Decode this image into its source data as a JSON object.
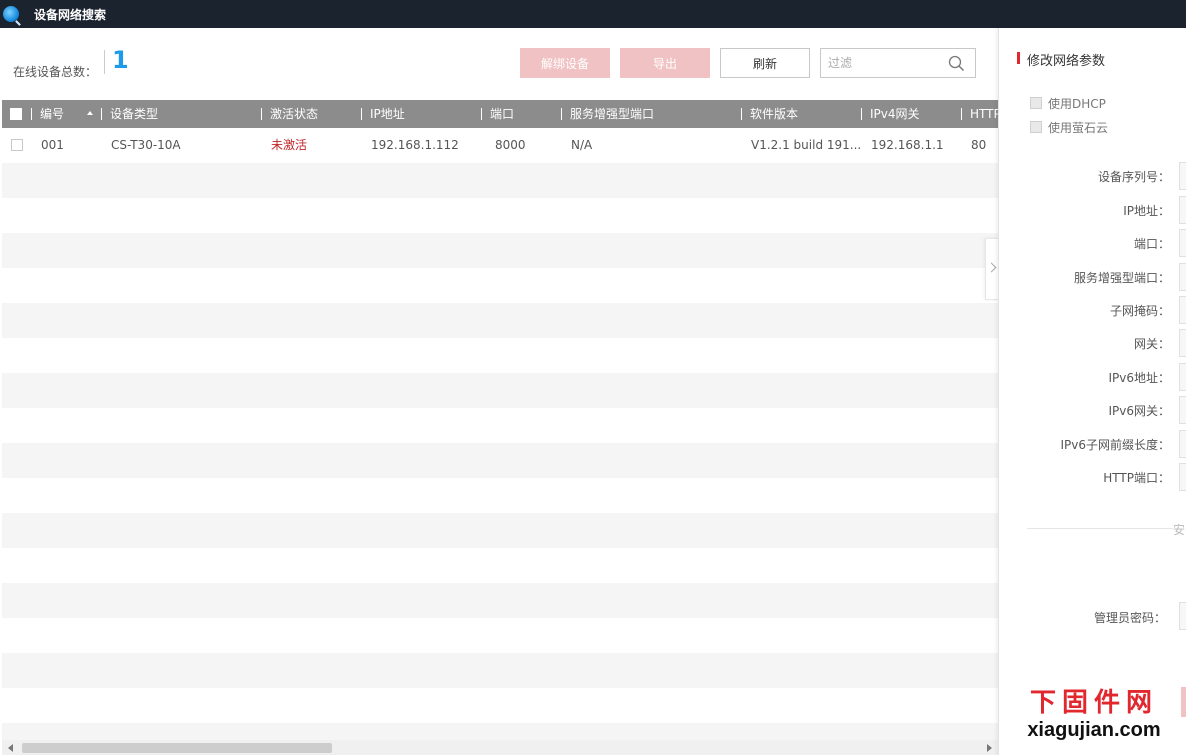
{
  "window": {
    "title": "设备网络搜索"
  },
  "toolbar": {
    "total_label": "在线设备总数：",
    "total_count": "1",
    "unbind_label": "解绑设备",
    "export_label": "导出",
    "refresh_label": "刷新",
    "filter_placeholder": "过滤",
    "filter_value": ""
  },
  "table": {
    "columns": [
      "编号",
      "设备类型",
      "激活状态",
      "IP地址",
      "端口",
      "服务增强型端口",
      "软件版本",
      "IPv4网关",
      "HTTP"
    ],
    "rows": [
      {
        "no": "001",
        "type": "CS-T30-10A",
        "status": "未激活",
        "ip": "192.168.1.112",
        "port": "8000",
        "enhanced_port": "N/A",
        "version": "V1.2.1 build 191...",
        "gateway": "192.168.1.1",
        "http": "80"
      }
    ]
  },
  "panel": {
    "title": "修改网络参数",
    "use_dhcp": "使用DHCP",
    "use_ezviz": "使用萤石云",
    "fields": {
      "serial": "设备序列号：",
      "ip": "IP地址：",
      "port": "端口：",
      "enhanced_port": "服务增强型端口：",
      "mask": "子网掩码：",
      "gateway": "网关：",
      "ipv6": "IPv6地址：",
      "ipv6_gateway": "IPv6网关：",
      "ipv6_prefix": "IPv6子网前缀长度：",
      "http_port": "HTTP端口："
    },
    "divider_text": "安",
    "admin_password": "管理员密码："
  },
  "watermark": {
    "cn": "下固件网",
    "en": "xiagujian.com"
  },
  "colors": {
    "accent_blue": "#1e9be8",
    "danger_red": "#c0262b",
    "disabled_btn": "#f1c2c3",
    "header_gray": "#8c8c8c",
    "titlebar": "#1b232e"
  }
}
